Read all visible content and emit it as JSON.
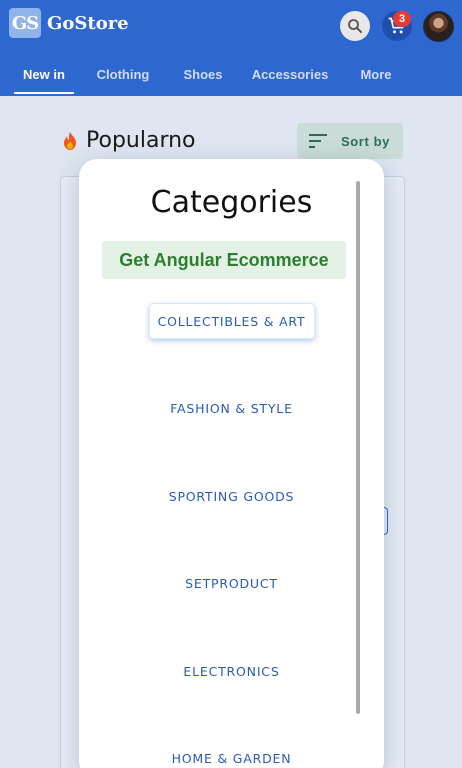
{
  "header": {
    "logo_text": "GS",
    "brand_name": "GoStore",
    "cart_count": "3"
  },
  "tabs": [
    "New in",
    "Clothing",
    "Shoes",
    "Accessories",
    "More"
  ],
  "section": {
    "title": "Popularno",
    "sort_label": "Sort by"
  },
  "categories_panel": {
    "title": "Categories",
    "promo": "Get Angular Ecommerce",
    "items": [
      "COLLECTIBLES & ART",
      "FASHION & STYLE",
      "SPORTING GOODS",
      "SETPRODUCT",
      "ELECTRONICS",
      "HOME & GARDEN"
    ],
    "selected_index": 0
  },
  "colors": {
    "app_bar": "#2f67d1",
    "category_text": "#2a5bb8",
    "promo_text": "#2e7d32",
    "badge": "#e53935"
  },
  "icons": [
    "search-icon",
    "cart-icon",
    "fire-icon",
    "sort-icon"
  ]
}
